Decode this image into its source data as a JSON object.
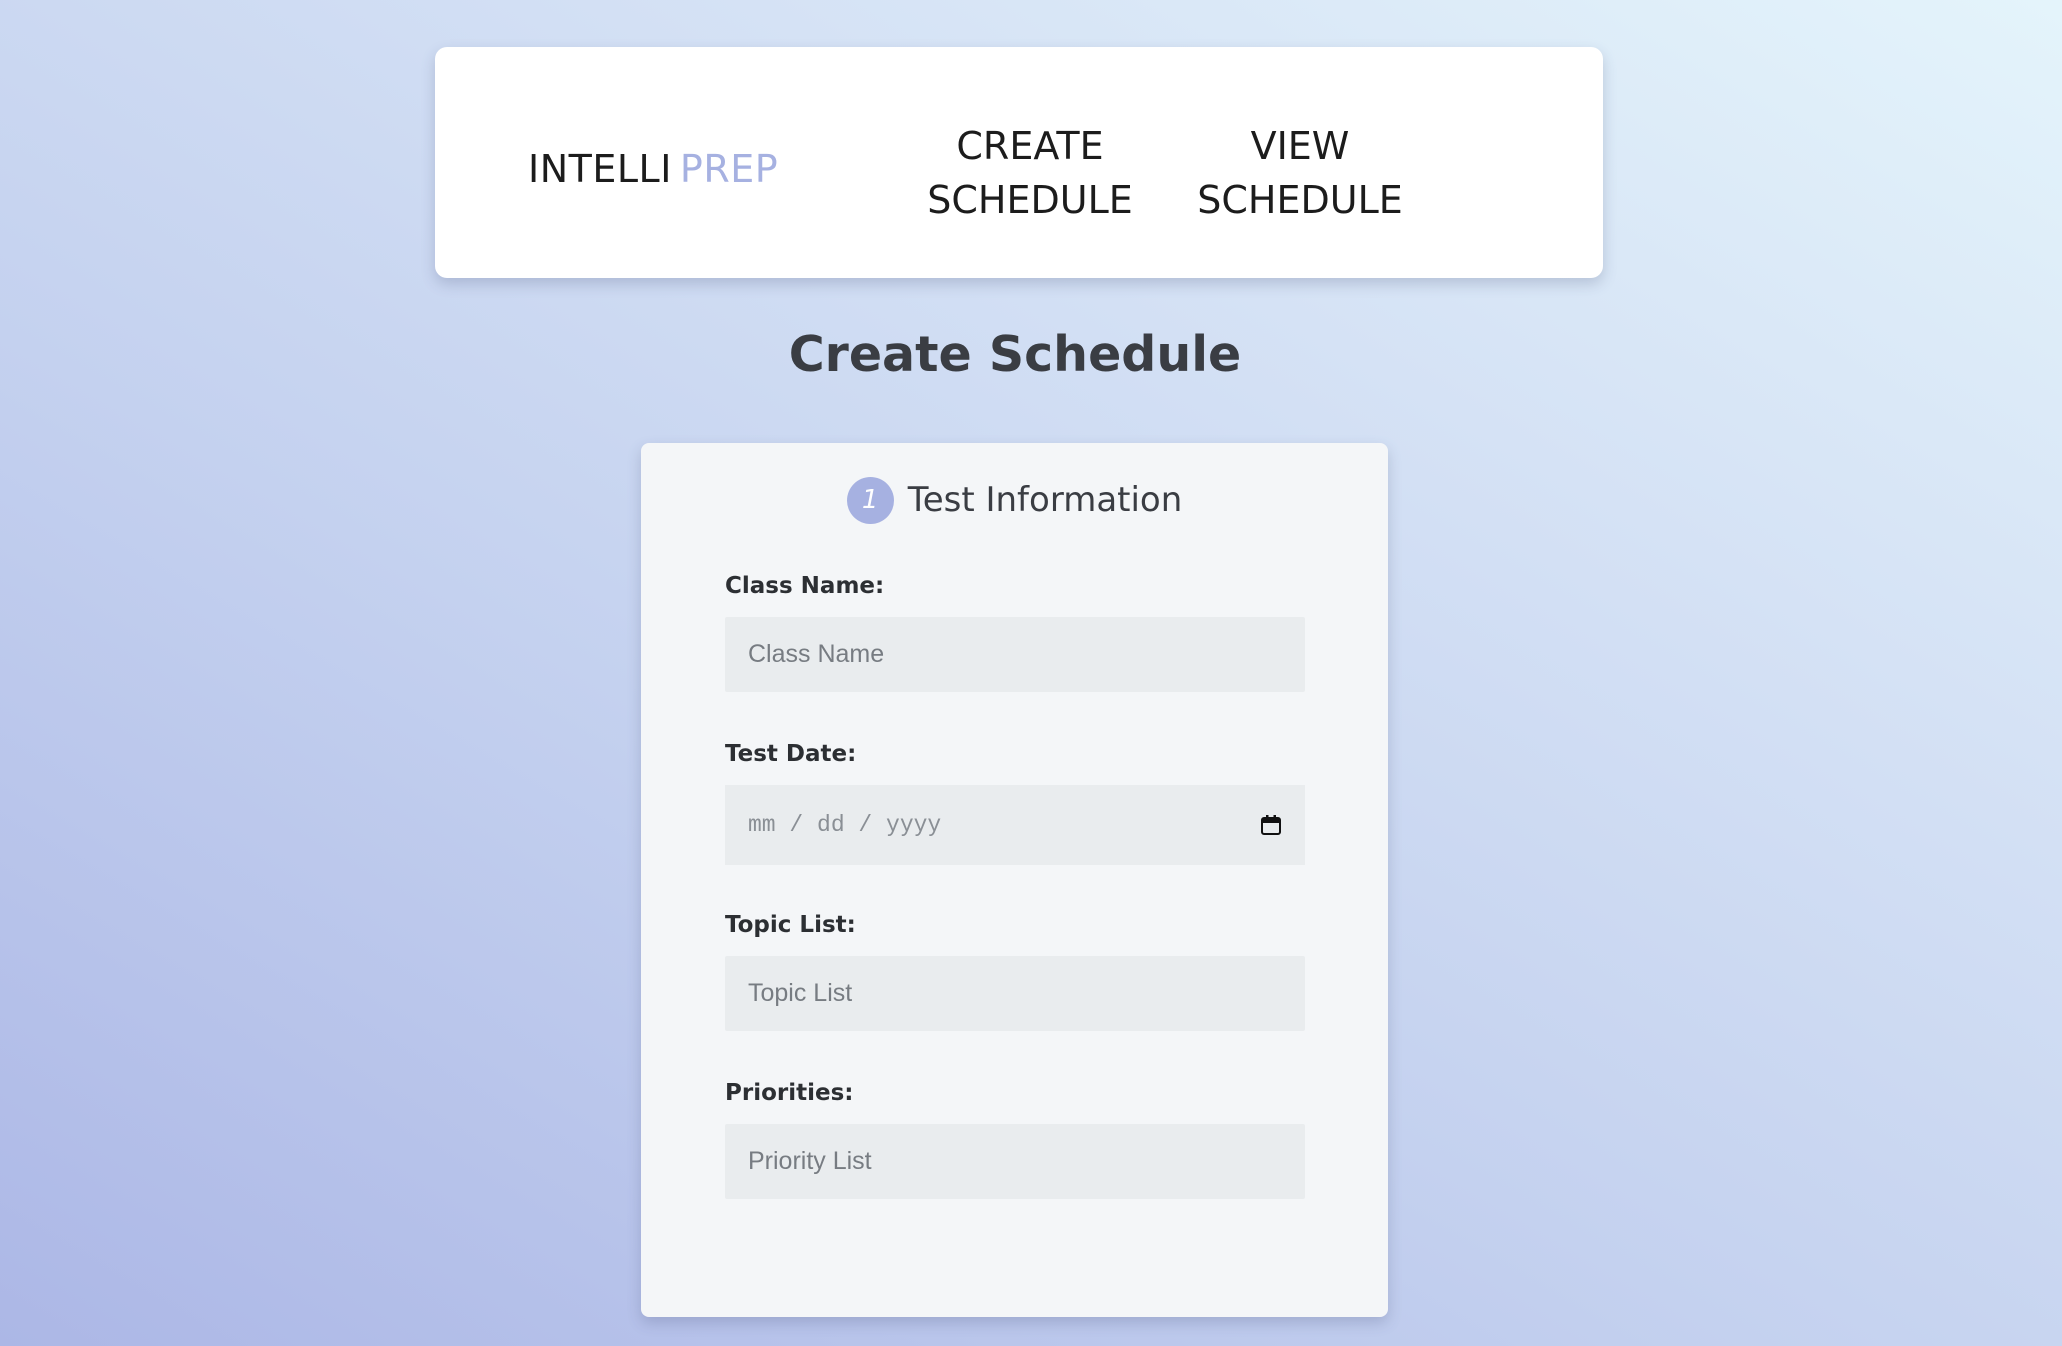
{
  "navbar": {
    "brand_part1": "INTELLI",
    "brand_part2": "PREP",
    "links": [
      {
        "line1": "CREATE",
        "line2": "SCHEDULE"
      },
      {
        "line1": "VIEW",
        "line2": "SCHEDULE"
      }
    ]
  },
  "page": {
    "title": "Create Schedule"
  },
  "card": {
    "step_number": "1",
    "title": "Test Information",
    "fields": {
      "class_name": {
        "label": "Class Name:",
        "placeholder": "Class Name",
        "value": ""
      },
      "test_date": {
        "label": "Test Date:",
        "placeholder": "mm / dd / yyyy",
        "value": ""
      },
      "topic_list": {
        "label": "Topic List:",
        "placeholder": "Topic List",
        "value": ""
      },
      "priorities": {
        "label": "Priorities:",
        "placeholder": "Priority List",
        "value": ""
      }
    }
  },
  "colors": {
    "accent": "#a6b1e1",
    "text": "#3a3d43",
    "input_bg": "#e9ecee",
    "card_bg": "#f4f6f8"
  },
  "icons": {
    "date_picker": "calendar-icon"
  }
}
